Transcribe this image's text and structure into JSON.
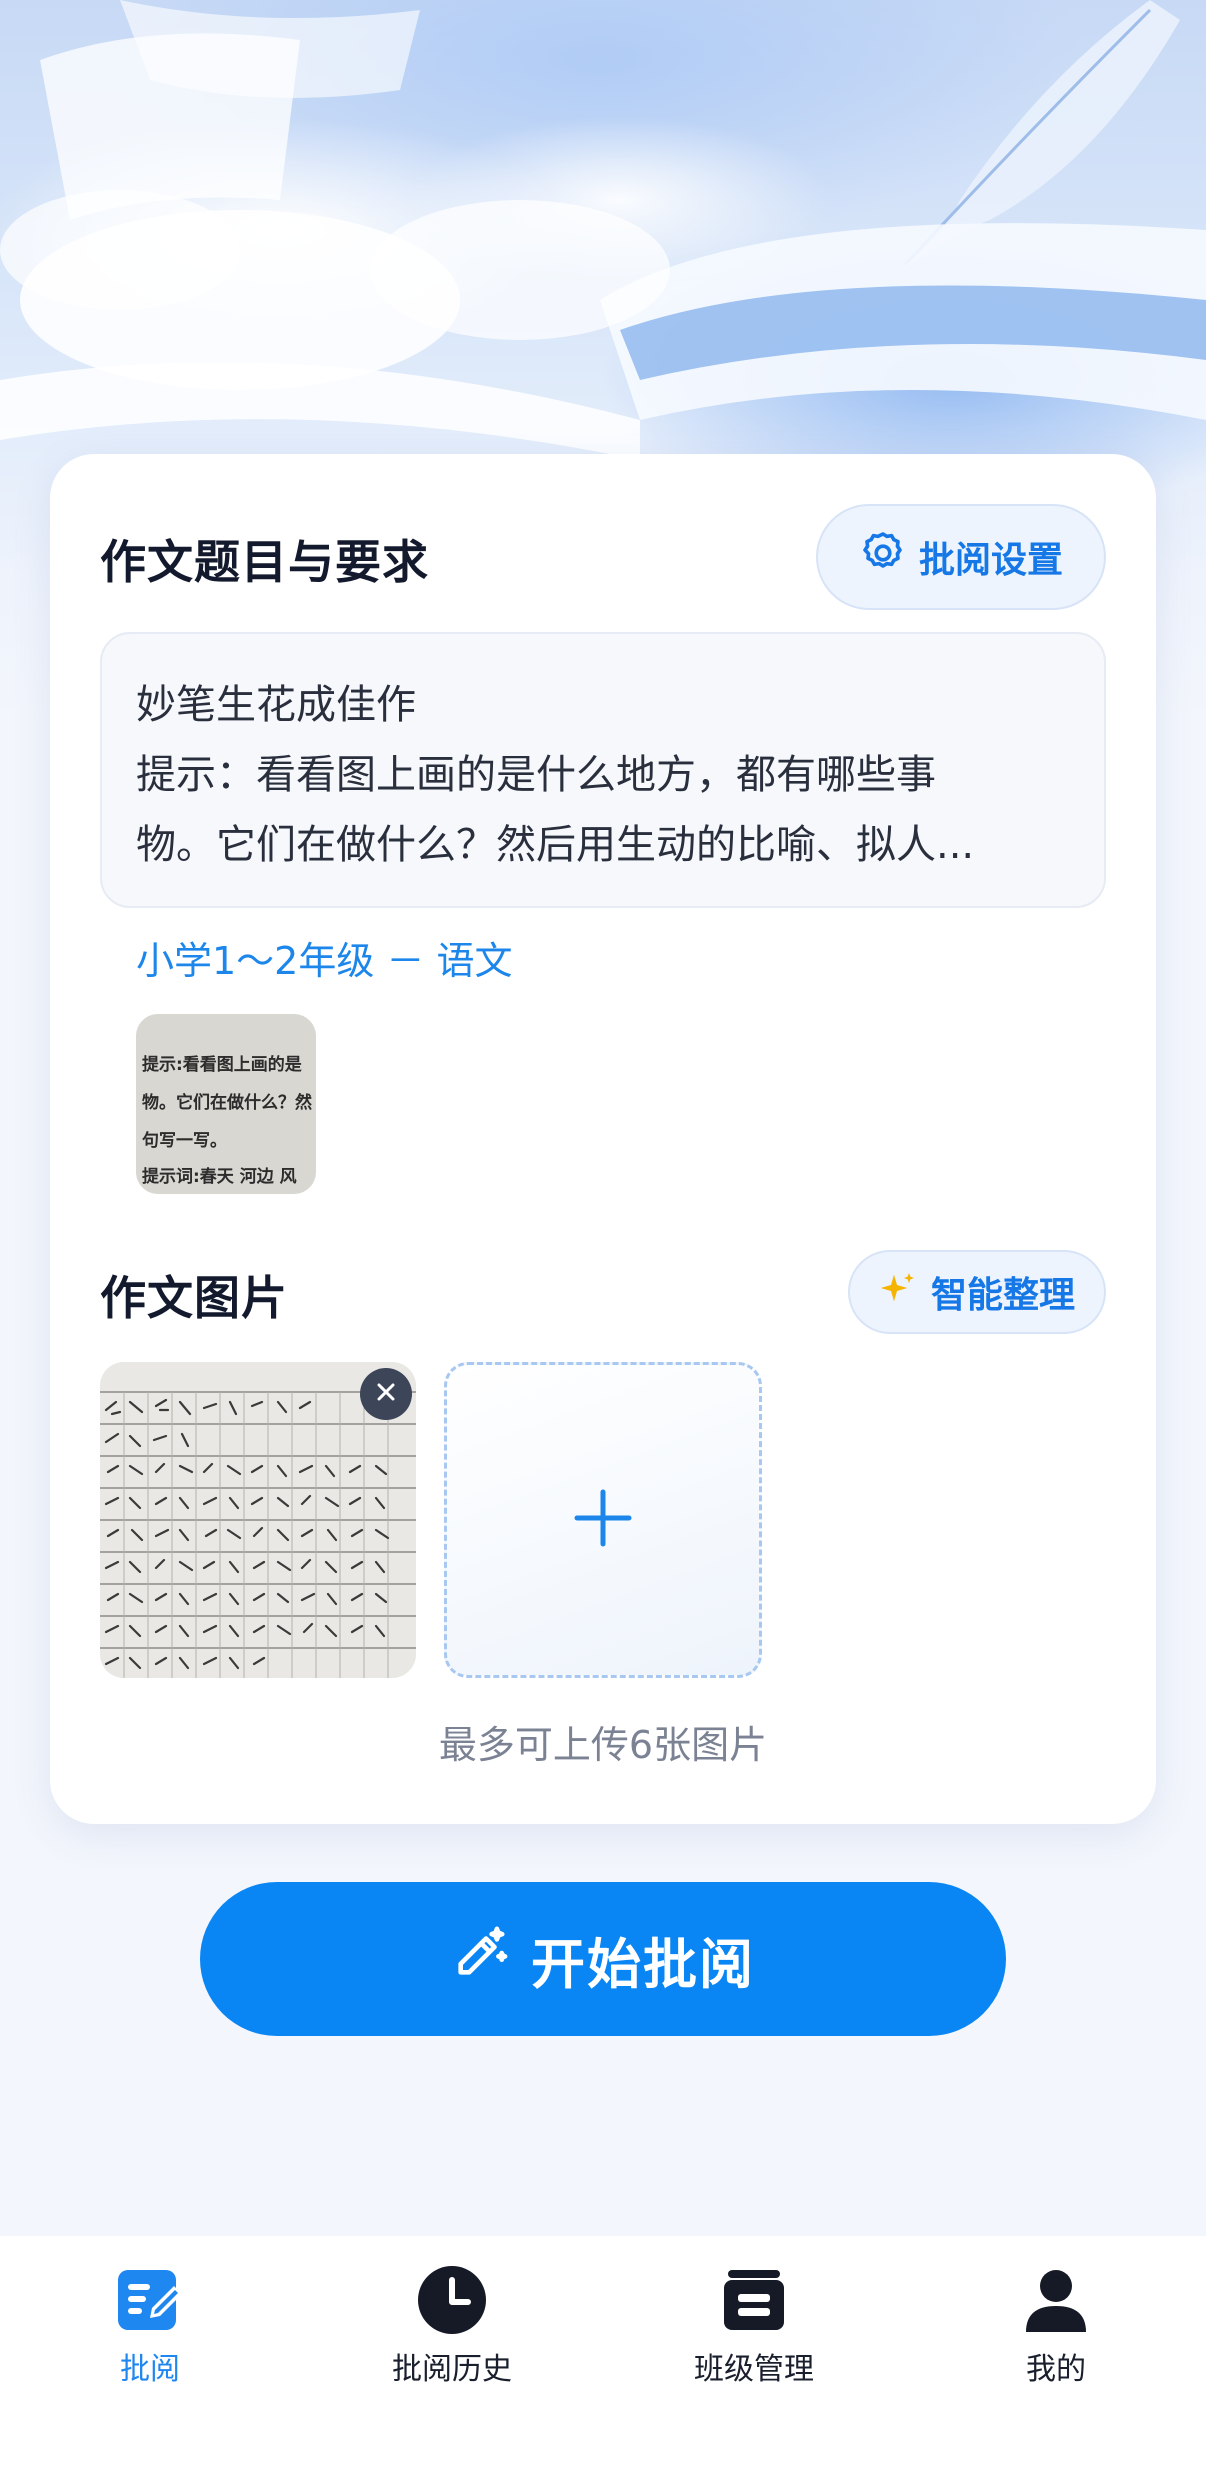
{
  "topic_section": {
    "title": "作文题目与要求",
    "settings_button": "批阅设置",
    "topic_title": "妙笔生花成佳作",
    "topic_hint_line1": "提示：看看图上画的是什么地方，都有哪些事",
    "topic_hint_line2": "物。它们在做什么？然后用生动的比喻、拟人...",
    "grade_subject": "小学1～2年级 － 语文",
    "prompt_image_text": [
      "提示:看看图上画的是",
      "物。它们在做什么？然",
      "句写一写。",
      "提示词:春天    河边    风"
    ]
  },
  "essay_section": {
    "title": "作文图片",
    "smart_button": "智能整理",
    "upload_hint": "最多可上传6张图片"
  },
  "start_button": "开始批阅",
  "tabs": [
    {
      "label": "批阅",
      "icon": "edit-doc-icon",
      "active": true
    },
    {
      "label": "批阅历史",
      "icon": "clock-icon",
      "active": false
    },
    {
      "label": "班级管理",
      "icon": "class-icon",
      "active": false
    },
    {
      "label": "我的",
      "icon": "user-icon",
      "active": false
    }
  ],
  "colors": {
    "accent": "#0a86f4",
    "link": "#1c86ea",
    "gold": "#f5b400"
  }
}
